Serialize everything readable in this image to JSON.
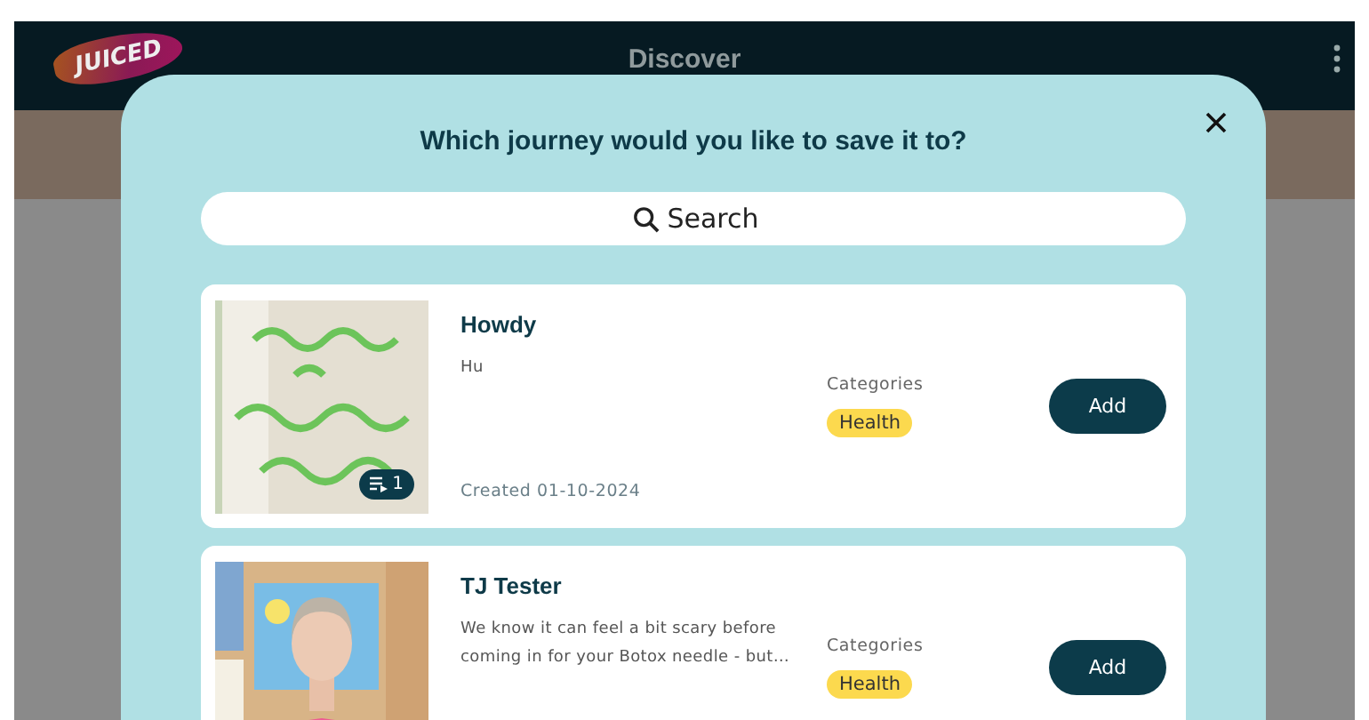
{
  "app_bar": {
    "logo": "JUICED",
    "title": "Discover"
  },
  "dialog": {
    "title": "Which journey would you like to save it to?",
    "search": {
      "placeholder": "Search"
    },
    "journeys": [
      {
        "title": "Howdy",
        "description": "Hu",
        "created": "Created 01-10-2024",
        "items_count": "1",
        "categories_label": "Categories",
        "categories": [
          "Health"
        ],
        "button": "Add",
        "thumbnail": {
          "kind": "picture"
        }
      },
      {
        "title": "TJ Tester",
        "description": "We know it can feel a bit scary before coming in for your Botox needle - but…",
        "categories_label": "Categories",
        "categories": [
          "Health"
        ],
        "button": "Add",
        "thumbnail": {
          "kind": "picture"
        }
      }
    ]
  }
}
